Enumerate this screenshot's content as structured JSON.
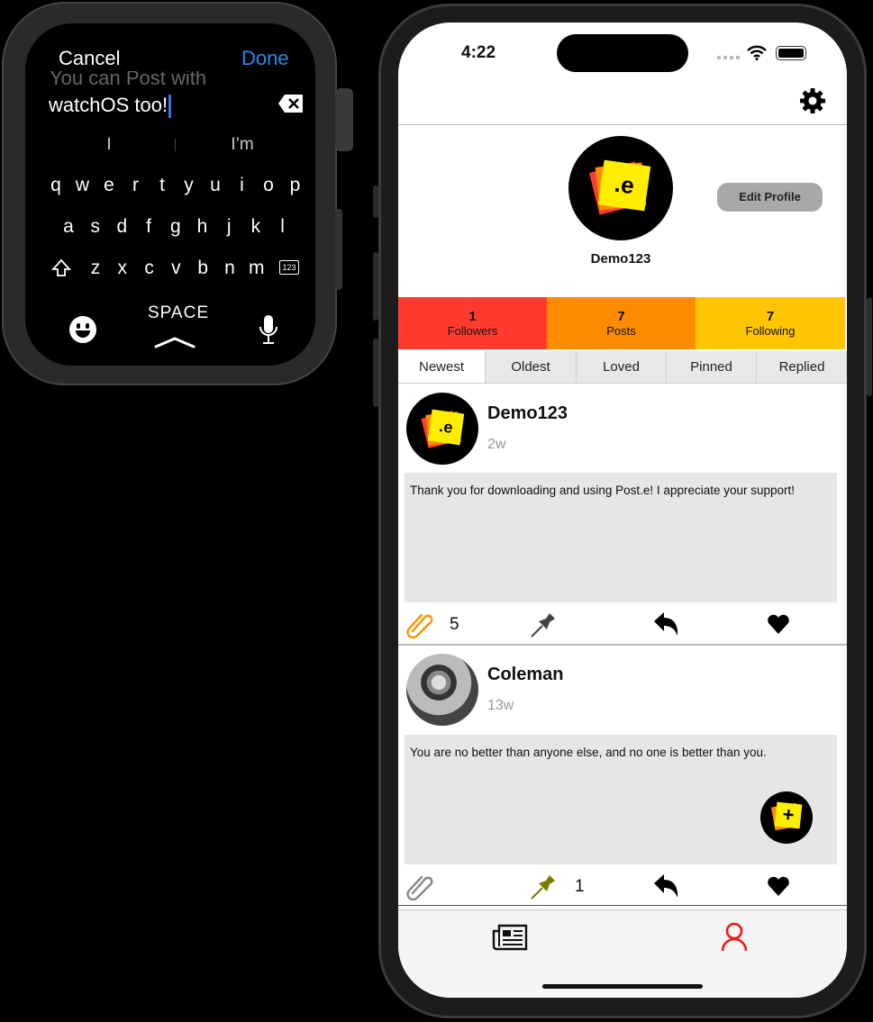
{
  "watch": {
    "cancel_label": "Cancel",
    "done_label": "Done",
    "text_prev_line": "You can Post with",
    "text_current_line": "watchOS too!",
    "suggestions": [
      "I",
      "I’m"
    ],
    "rows": [
      [
        "q",
        "w",
        "e",
        "r",
        "t",
        "y",
        "u",
        "i",
        "o",
        "p"
      ],
      [
        "a",
        "s",
        "d",
        "f",
        "g",
        "h",
        "j",
        "k",
        "l"
      ],
      [
        "z",
        "x",
        "c",
        "v",
        "b",
        "n",
        "m"
      ]
    ],
    "numbers_key": "123",
    "space_label": "SPACE",
    "accent": "#2d88f0",
    "icons": [
      "delete-icon",
      "shift-icon",
      "emoji-icon",
      "microphone-icon"
    ]
  },
  "phone": {
    "status": {
      "time": "4:22"
    },
    "profile": {
      "username": "Demo123",
      "edit_label": "Edit Profile",
      "logo_text": ".e"
    },
    "stats": [
      {
        "value": "1",
        "label": "Followers",
        "color": "#ff3b30"
      },
      {
        "value": "7",
        "label": "Posts",
        "color": "#ff8c00"
      },
      {
        "value": "7",
        "label": "Following",
        "color": "#ffc500"
      }
    ],
    "tabs": [
      "Newest",
      "Oldest",
      "Loved",
      "Pinned",
      "Replied"
    ],
    "active_tab": "Newest",
    "posts": [
      {
        "author": "Demo123",
        "time": "2w",
        "text": "Thank you for downloading and using Post.e! I appreciate your support!",
        "attachments": "5",
        "pins": ""
      },
      {
        "author": "Coleman",
        "time": "13w",
        "text": "You are no better than anyone else, and no one is better than you.",
        "attachments": "",
        "pins": "1"
      }
    ],
    "fab_label": "+",
    "tabbar": [
      {
        "icon": "newspaper-icon"
      },
      {
        "icon": "person-icon",
        "color": "#ee1c1c"
      }
    ]
  }
}
